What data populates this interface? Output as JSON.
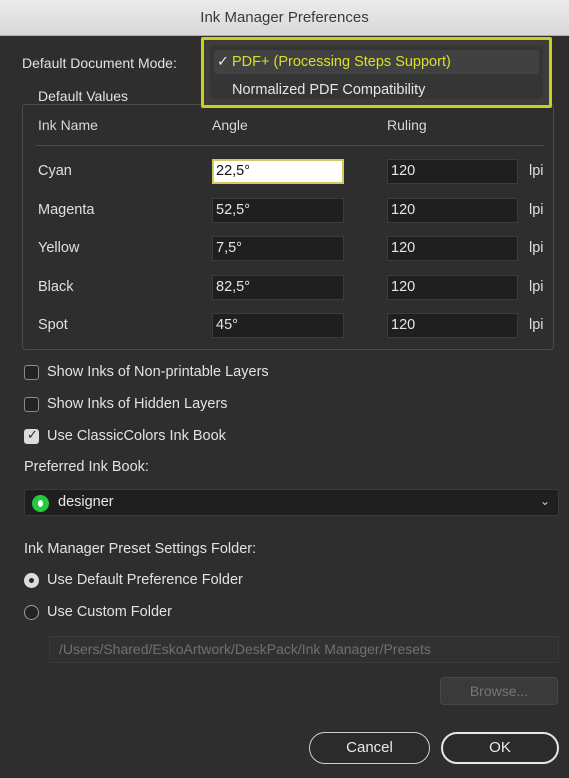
{
  "window": {
    "title": "Ink Manager Preferences"
  },
  "document_mode": {
    "label": "Default Document Mode:",
    "options": [
      {
        "label": "PDF+ (Processing Steps Support)",
        "selected": true
      },
      {
        "label": "Normalized PDF Compatibility",
        "selected": false
      }
    ],
    "highlight_color": "#c9d21a"
  },
  "defaults": {
    "group_title": "Default Values",
    "headers": {
      "ink_name": "Ink Name",
      "angle": "Angle",
      "ruling": "Ruling"
    },
    "rows": [
      {
        "name": "Cyan",
        "angle": "22,5°",
        "ruling": "120",
        "unit": "lpi"
      },
      {
        "name": "Magenta",
        "angle": "52,5°",
        "ruling": "120",
        "unit": "lpi"
      },
      {
        "name": "Yellow",
        "angle": "7,5°",
        "ruling": "120",
        "unit": "lpi"
      },
      {
        "name": "Black",
        "angle": "82,5°",
        "ruling": "120",
        "unit": "lpi"
      },
      {
        "name": "Spot",
        "angle": "45°",
        "ruling": "120",
        "unit": "lpi"
      }
    ]
  },
  "options": {
    "show_nonprintable": {
      "label": "Show Inks of Non-printable Layers",
      "checked": false
    },
    "show_hidden": {
      "label": "Show Inks of Hidden Layers",
      "checked": false
    },
    "use_classiccolors": {
      "label": "Use ClassicColors Ink Book",
      "checked": true
    }
  },
  "ink_book": {
    "label": "Preferred Ink Book:",
    "value": "designer",
    "icon": "green-book-icon"
  },
  "preset_folder": {
    "label": "Ink Manager Preset Settings Folder:",
    "use_default": {
      "label": "Use Default Preference Folder",
      "selected": true
    },
    "use_custom": {
      "label": "Use Custom Folder",
      "selected": false
    },
    "path_placeholder": "/Users/Shared/EskoArtwork/DeskPack/Ink Manager/Presets",
    "browse_label": "Browse..."
  },
  "buttons": {
    "cancel": "Cancel",
    "ok": "OK"
  }
}
